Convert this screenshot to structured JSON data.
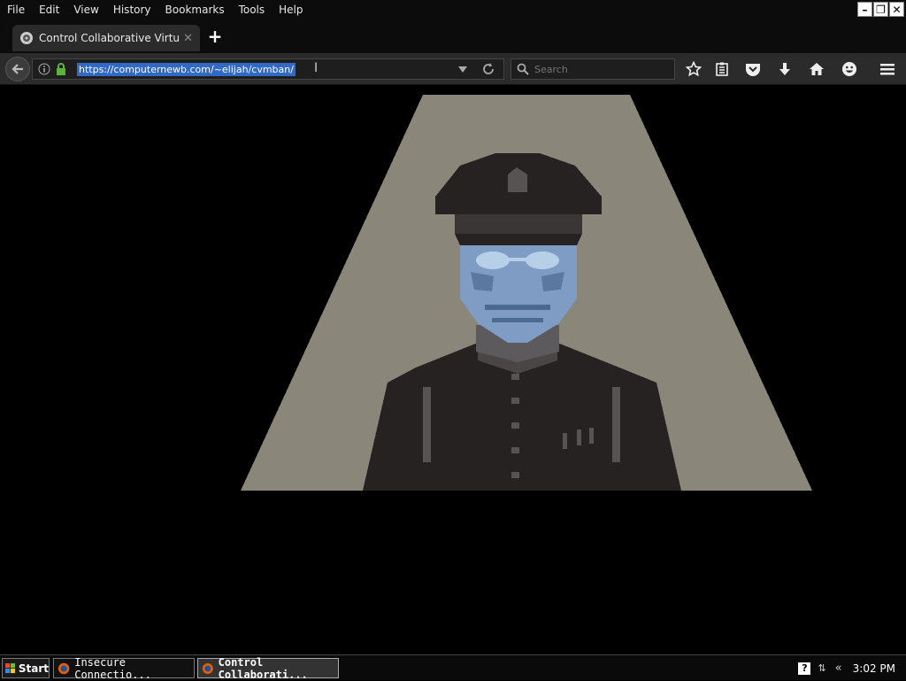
{
  "menu": [
    "File",
    "Edit",
    "View",
    "History",
    "Bookmarks",
    "Tools",
    "Help"
  ],
  "menu_underline": [
    "F",
    "E",
    "V",
    "s",
    "B",
    "T",
    "H"
  ],
  "tab": {
    "title": "Control Collaborative Virtual ..."
  },
  "url": "https://computernewb.com/~elijah/cvmban/",
  "search": {
    "placeholder": "Search"
  },
  "taskbar": {
    "start": "Start",
    "tasks": [
      "Insecure Connectio...",
      "Control Collaborati..."
    ],
    "clock": "3:02 PM"
  },
  "colors": {
    "spotlight": "#8a8679",
    "face": "#7f9dc4",
    "uniform": "#262222",
    "selection": "#3169c6"
  }
}
